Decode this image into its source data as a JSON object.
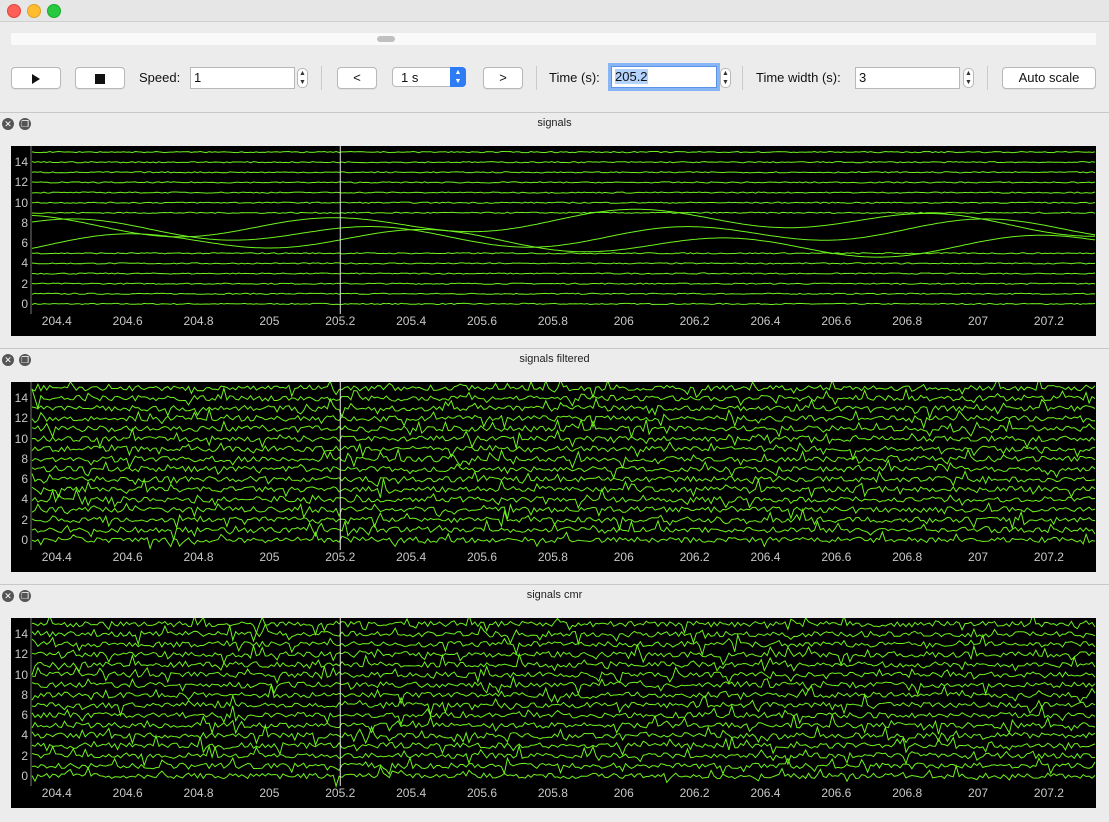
{
  "toolbar": {
    "play_icon": "play-icon",
    "stop_icon": "stop-icon",
    "speed_label": "Speed:",
    "speed_value": "1",
    "prev_label": "<",
    "step_value": "1 s",
    "next_label": ">",
    "time_label": "Time (s):",
    "time_value": "205.2",
    "time_width_label": "Time width (s):",
    "time_width_value": "3",
    "auto_scale_label": "Auto scale"
  },
  "docks": [
    {
      "title": "signals",
      "style": "smooth"
    },
    {
      "title": "signals filtered",
      "style": "noisy"
    },
    {
      "title": "signals cmr",
      "style": "noisy"
    }
  ],
  "colors": {
    "trace": "#6ef21e",
    "cursor_line": "#e8e8e8",
    "plot_bg": "#000000",
    "tick_text": "#c8c8c8"
  },
  "chart_data": {
    "type": "line",
    "x_ticks": [
      "204.4",
      "204.6",
      "204.8",
      "205",
      "205.2",
      "205.4",
      "205.6",
      "205.8",
      "206",
      "206.2",
      "206.4",
      "206.6",
      "206.8",
      "207",
      "207.2"
    ],
    "y_ticks": [
      "14",
      "12",
      "10",
      "8",
      "6",
      "4",
      "2",
      "0"
    ],
    "xlim": [
      204.33,
      207.33
    ],
    "ylim": [
      -0.7,
      15.5
    ],
    "cursor_time": 205.2,
    "channel_count": 16
  }
}
